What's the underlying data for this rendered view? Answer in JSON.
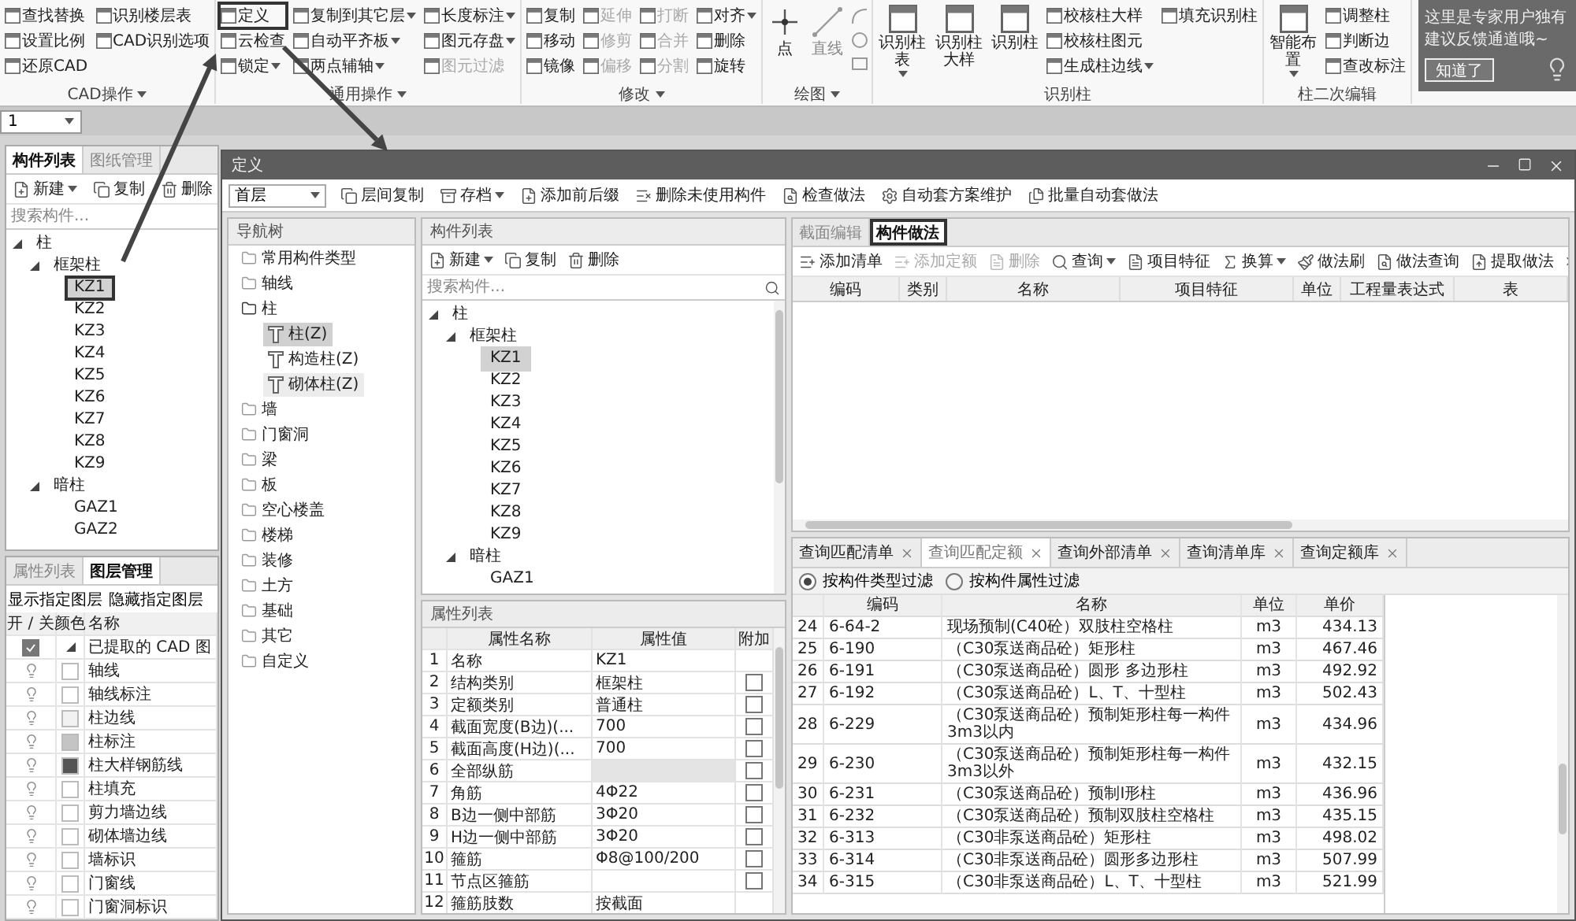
{
  "ribbon": {
    "groups": [
      {
        "label": "CAD操作",
        "dropdown": true,
        "columns": [
          {
            "kind": "small",
            "items": [
              {
                "label": "查找替换",
                "dropdown": false,
                "disabled": false,
                "outlined": false
              },
              {
                "label": "设置比例",
                "dropdown": false,
                "disabled": false,
                "outlined": false
              },
              {
                "label": "还原CAD",
                "dropdown": false,
                "disabled": false,
                "outlined": false
              }
            ]
          },
          {
            "kind": "small",
            "items": [
              {
                "label": "识别楼层表",
                "dropdown": false,
                "disabled": false,
                "outlined": false
              },
              {
                "label": "CAD识别选项",
                "dropdown": false,
                "disabled": false,
                "outlined": false
              }
            ]
          }
        ]
      },
      {
        "label": "通用操作",
        "dropdown": true,
        "columns": [
          {
            "kind": "small",
            "items": [
              {
                "label": "定义",
                "dropdown": false,
                "disabled": false,
                "outlined": true
              },
              {
                "label": "云检查",
                "dropdown": false,
                "disabled": false,
                "outlined": false
              },
              {
                "label": "锁定",
                "dropdown": true,
                "disabled": false,
                "outlined": false
              }
            ]
          },
          {
            "kind": "small",
            "items": [
              {
                "label": "复制到其它层",
                "dropdown": true,
                "disabled": false,
                "outlined": false
              },
              {
                "label": "自动平齐板",
                "dropdown": true,
                "disabled": false,
                "outlined": false
              },
              {
                "label": "两点辅轴",
                "dropdown": true,
                "disabled": false,
                "outlined": false
              }
            ]
          },
          {
            "kind": "small",
            "items": [
              {
                "label": "长度标注",
                "dropdown": true,
                "disabled": false,
                "outlined": false
              },
              {
                "label": "图元存盘",
                "dropdown": true,
                "disabled": false,
                "outlined": false
              },
              {
                "label": "图元过滤",
                "dropdown": false,
                "disabled": true,
                "outlined": false
              }
            ]
          }
        ]
      },
      {
        "label": "修改",
        "dropdown": true,
        "columns": [
          {
            "kind": "small",
            "items": [
              {
                "label": "复制",
                "dropdown": false,
                "disabled": false,
                "outlined": false
              },
              {
                "label": "移动",
                "dropdown": false,
                "disabled": false,
                "outlined": false
              },
              {
                "label": "镜像",
                "dropdown": false,
                "disabled": false,
                "outlined": false
              }
            ]
          },
          {
            "kind": "small",
            "items": [
              {
                "label": "延伸",
                "dropdown": false,
                "disabled": true,
                "outlined": false
              },
              {
                "label": "修剪",
                "dropdown": false,
                "disabled": true,
                "outlined": false
              },
              {
                "label": "偏移",
                "dropdown": false,
                "disabled": true,
                "outlined": false
              }
            ]
          },
          {
            "kind": "small",
            "items": [
              {
                "label": "打断",
                "dropdown": false,
                "disabled": true,
                "outlined": false
              },
              {
                "label": "合并",
                "dropdown": false,
                "disabled": true,
                "outlined": false
              },
              {
                "label": "分割",
                "dropdown": false,
                "disabled": true,
                "outlined": false
              }
            ]
          },
          {
            "kind": "small",
            "items": [
              {
                "label": "对齐",
                "dropdown": true,
                "disabled": false,
                "outlined": false
              },
              {
                "label": "删除",
                "dropdown": false,
                "disabled": false,
                "outlined": false
              },
              {
                "label": "旋转",
                "dropdown": false,
                "disabled": false,
                "outlined": false
              }
            ]
          }
        ]
      },
      {
        "label": "绘图",
        "dropdown": true,
        "columns": [
          {
            "kind": "tools",
            "items": [
              {
                "label": "点",
                "dropdown": false,
                "disabled": false,
                "outlined": false
              },
              {
                "label": "直线",
                "dropdown": false,
                "disabled": true,
                "outlined": false
              }
            ]
          },
          {
            "kind": "shapes"
          }
        ]
      },
      {
        "label": "识别柱",
        "dropdown": false,
        "columns": [
          {
            "kind": "large",
            "items": [
              {
                "label": "识别柱表",
                "dropdown": true,
                "disabled": false,
                "outlined": false
              },
              {
                "label": "识别柱大样",
                "dropdown": false,
                "disabled": false,
                "outlined": false
              },
              {
                "label": "识别柱",
                "dropdown": false,
                "disabled": false,
                "outlined": false
              }
            ]
          },
          {
            "kind": "small",
            "items": [
              {
                "label": "校核柱大样",
                "dropdown": false,
                "disabled": false,
                "outlined": false
              },
              {
                "label": "校核柱图元",
                "dropdown": false,
                "disabled": false,
                "outlined": false
              },
              {
                "label": "生成柱边线",
                "dropdown": true,
                "disabled": false,
                "outlined": false
              }
            ]
          },
          {
            "kind": "small",
            "items": [
              {
                "label": "填充识别柱",
                "dropdown": false,
                "disabled": false,
                "outlined": false
              }
            ]
          }
        ]
      },
      {
        "label": "柱二次编辑",
        "dropdown": false,
        "columns": [
          {
            "kind": "large",
            "items": [
              {
                "label": "智能布置",
                "dropdown": true,
                "disabled": false,
                "outlined": false
              }
            ]
          },
          {
            "kind": "small",
            "items": [
              {
                "label": "调整柱",
                "dropdown": false,
                "disabled": false,
                "outlined": false
              },
              {
                "label": "判断边",
                "dropdown": false,
                "disabled": false,
                "outlined": false
              },
              {
                "label": "查改标注",
                "dropdown": false,
                "disabled": false,
                "outlined": false
              }
            ]
          }
        ]
      }
    ]
  },
  "tooltip": {
    "lines": [
      "这里是专家用户独有",
      "建议反馈通道哦~"
    ],
    "button": "知道了"
  },
  "floor_select": {
    "value": "1"
  },
  "component_panel": {
    "tabs": [
      {
        "label": "构件列表",
        "selected": true
      },
      {
        "label": "图纸管理",
        "selected": false
      }
    ],
    "toolbar": [
      {
        "label": "新建",
        "dropdown": true
      },
      {
        "label": "复制",
        "dropdown": false
      },
      {
        "label": "删除",
        "dropdown": false
      }
    ],
    "search": {
      "placeholder": "搜索构件..."
    },
    "tree": [
      {
        "label": "柱",
        "expanded": true,
        "selected": false,
        "outlined": false,
        "children": [
          {
            "label": "框架柱",
            "expanded": true,
            "selected": false,
            "outlined": false,
            "children": [
              {
                "label": "KZ1",
                "selected": true,
                "outlined": true
              },
              {
                "label": "KZ2",
                "selected": false,
                "outlined": false
              },
              {
                "label": "KZ3",
                "selected": false,
                "outlined": false
              },
              {
                "label": "KZ4",
                "selected": false,
                "outlined": false
              },
              {
                "label": "KZ5",
                "selected": false,
                "outlined": false
              },
              {
                "label": "KZ6",
                "selected": false,
                "outlined": false
              },
              {
                "label": "KZ7",
                "selected": false,
                "outlined": false
              },
              {
                "label": "KZ8",
                "selected": false,
                "outlined": false
              },
              {
                "label": "KZ9",
                "selected": false,
                "outlined": false
              }
            ]
          },
          {
            "label": "暗柱",
            "expanded": true,
            "selected": false,
            "outlined": false,
            "children": [
              {
                "label": "GAZ1",
                "selected": false,
                "outlined": false
              },
              {
                "label": "GAZ2",
                "selected": false,
                "outlined": false
              }
            ]
          }
        ]
      }
    ]
  },
  "layer_panel": {
    "tabs": [
      {
        "label": "属性列表",
        "selected": false
      },
      {
        "label": "图层管理",
        "selected": true
      }
    ],
    "buttons": [
      "显示指定图层",
      "隐藏指定图层"
    ],
    "columns": [
      "开 / 关",
      "颜色",
      "名称"
    ],
    "rows": [
      {
        "kind": "group",
        "name": "已提取的 CAD 图",
        "checked": true
      },
      {
        "kind": "layer",
        "name": "轴线",
        "color": "#ffffff"
      },
      {
        "kind": "layer",
        "name": "轴线标注",
        "color": "#ffffff"
      },
      {
        "kind": "layer",
        "name": "柱边线",
        "color": "#f2f2f2"
      },
      {
        "kind": "layer",
        "name": "柱标注",
        "color": "#c4c4c4"
      },
      {
        "kind": "layer",
        "name": "柱大样钢筋线",
        "color": "#555555"
      },
      {
        "kind": "layer",
        "name": "柱填充",
        "color": "#ffffff"
      },
      {
        "kind": "layer",
        "name": "剪力墙边线",
        "color": "#ffffff"
      },
      {
        "kind": "layer",
        "name": "砌体墙边线",
        "color": "#ffffff"
      },
      {
        "kind": "layer",
        "name": "墙标识",
        "color": "#ffffff"
      },
      {
        "kind": "layer",
        "name": "门窗线",
        "color": "#ffffff"
      },
      {
        "kind": "layer",
        "name": "门窗洞标识",
        "color": "#ffffff"
      }
    ]
  },
  "dialog": {
    "title": "定义",
    "toolbar": {
      "floor": "首层",
      "items": [
        {
          "label": "层间复制",
          "dropdown": false
        },
        {
          "label": "存档",
          "dropdown": true
        },
        {
          "label": "添加前后缀",
          "dropdown": false
        },
        {
          "label": "删除未使用构件",
          "dropdown": false
        },
        {
          "label": "检查做法",
          "dropdown": false
        },
        {
          "label": "自动套方案维护",
          "dropdown": false
        },
        {
          "label": "批量自动套做法",
          "dropdown": false
        }
      ]
    },
    "nav": {
      "title": "导航树",
      "items": [
        {
          "label": "常用构件类型",
          "expanded": false
        },
        {
          "label": "轴线",
          "expanded": false
        },
        {
          "label": "柱",
          "expanded": true,
          "children": [
            {
              "label": "柱(Z)",
              "selected": true,
              "hovered": false
            },
            {
              "label": "构造柱(Z)",
              "selected": false,
              "hovered": false
            },
            {
              "label": "砌体柱(Z)",
              "selected": false,
              "hovered": true
            }
          ]
        },
        {
          "label": "墙",
          "expanded": false
        },
        {
          "label": "门窗洞",
          "expanded": false
        },
        {
          "label": "梁",
          "expanded": false
        },
        {
          "label": "板",
          "expanded": false
        },
        {
          "label": "空心楼盖",
          "expanded": false
        },
        {
          "label": "楼梯",
          "expanded": false
        },
        {
          "label": "装修",
          "expanded": false
        },
        {
          "label": "土方",
          "expanded": false
        },
        {
          "label": "基础",
          "expanded": false
        },
        {
          "label": "其它",
          "expanded": false
        },
        {
          "label": "自定义",
          "expanded": false
        }
      ]
    },
    "components": {
      "title": "构件列表",
      "toolbar": [
        {
          "label": "新建",
          "dropdown": true
        },
        {
          "label": "复制",
          "dropdown": false
        },
        {
          "label": "删除",
          "dropdown": false
        }
      ],
      "search": {
        "placeholder": "搜索构件..."
      },
      "tree": [
        {
          "label": "柱",
          "expanded": true,
          "selected": false,
          "children": [
            {
              "label": "框架柱",
              "expanded": true,
              "selected": false,
              "children": [
                {
                  "label": "KZ1",
                  "selected": true
                },
                {
                  "label": "KZ2",
                  "selected": false
                },
                {
                  "label": "KZ3",
                  "selected": false
                },
                {
                  "label": "KZ4",
                  "selected": false
                },
                {
                  "label": "KZ5",
                  "selected": false
                },
                {
                  "label": "KZ6",
                  "selected": false
                },
                {
                  "label": "KZ7",
                  "selected": false
                },
                {
                  "label": "KZ8",
                  "selected": false
                },
                {
                  "label": "KZ9",
                  "selected": false
                }
              ]
            },
            {
              "label": "暗柱",
              "expanded": true,
              "selected": false,
              "children": [
                {
                  "label": "GAZ1",
                  "selected": false
                }
              ]
            }
          ]
        }
      ]
    },
    "properties": {
      "title": "属性列表",
      "columns": [
        "属性名称",
        "属性值",
        "附加"
      ],
      "rows": [
        {
          "index": "1",
          "name": "名称",
          "value": "KZ1",
          "kind": "plain",
          "disabled": false
        },
        {
          "index": "2",
          "name": "结构类别",
          "value": "框架柱",
          "kind": "check",
          "checked": false,
          "disabled": false
        },
        {
          "index": "3",
          "name": "定额类别",
          "value": "普通柱",
          "kind": "check",
          "checked": false,
          "disabled": false
        },
        {
          "index": "4",
          "name": "截面宽度(B边)(...",
          "value": "700",
          "kind": "check",
          "checked": false,
          "disabled": false
        },
        {
          "index": "5",
          "name": "截面高度(H边)(...",
          "value": "700",
          "kind": "check",
          "checked": false,
          "disabled": false
        },
        {
          "index": "6",
          "name": "全部纵筋",
          "kind": "check",
          "checked": false,
          "disabled": true
        },
        {
          "index": "7",
          "name": "角筋",
          "value": "4Φ22",
          "kind": "check",
          "checked": false,
          "disabled": false
        },
        {
          "index": "8",
          "name": "B边一侧中部筋",
          "value": "3Φ20",
          "kind": "check",
          "checked": false,
          "disabled": false
        },
        {
          "index": "9",
          "name": "H边一侧中部筋",
          "value": "3Φ20",
          "kind": "check",
          "checked": false,
          "disabled": false
        },
        {
          "index": "10",
          "name": "箍筋",
          "value": "Φ8@100/200",
          "kind": "check",
          "checked": false,
          "disabled": false
        },
        {
          "index": "11",
          "name": "节点区箍筋",
          "kind": "check",
          "checked": false,
          "disabled": false
        },
        {
          "index": "12",
          "name": "箍筋肢数",
          "value": "按截面",
          "kind": "plain",
          "disabled": false
        }
      ]
    },
    "methods": {
      "tabs": [
        {
          "label": "截面编辑",
          "selected": false,
          "outlined": false
        },
        {
          "label": "构件做法",
          "selected": true,
          "outlined": true
        }
      ],
      "toolbar": [
        {
          "label": "添加清单",
          "dropdown": false,
          "disabled": false
        },
        {
          "label": "添加定额",
          "dropdown": false,
          "disabled": true
        },
        {
          "label": "删除",
          "dropdown": false,
          "disabled": true
        },
        {
          "label": "查询",
          "dropdown": true,
          "disabled": false
        },
        {
          "label": "项目特征",
          "dropdown": false,
          "disabled": false
        },
        {
          "label": "换算",
          "dropdown": true,
          "disabled": false
        },
        {
          "label": "做法刷",
          "dropdown": false,
          "disabled": false
        },
        {
          "label": "做法查询",
          "dropdown": false,
          "disabled": false
        },
        {
          "label": "提取做法",
          "dropdown": false,
          "disabled": false
        }
      ],
      "columns": [
        "编码",
        "类别",
        "名称",
        "项目特征",
        "单位",
        "工程量表达式",
        "表"
      ]
    },
    "query": {
      "tabs": [
        {
          "label": "查询匹配清单",
          "selected": false
        },
        {
          "label": "查询匹配定额",
          "selected": true
        },
        {
          "label": "查询外部清单",
          "selected": false
        },
        {
          "label": "查询清单库",
          "selected": false
        },
        {
          "label": "查询定额库",
          "selected": false
        }
      ],
      "filters": [
        {
          "label": "按构件类型过滤",
          "selected": true
        },
        {
          "label": "按构件属性过滤",
          "selected": false
        }
      ],
      "columns": [
        "编码",
        "名称",
        "单位",
        "单价"
      ],
      "rows": [
        {
          "index": "24",
          "code": "6-64-2",
          "name": "现场预制(C40砼）双肢柱空格柱",
          "unit": "m3",
          "price": "434.13"
        },
        {
          "index": "25",
          "code": "6-190",
          "name": "（C30泵送商品砼）矩形柱",
          "unit": "m3",
          "price": "467.46"
        },
        {
          "index": "26",
          "code": "6-191",
          "name": "（C30泵送商品砼）圆形 多边形柱",
          "unit": "m3",
          "price": "492.92"
        },
        {
          "index": "27",
          "code": "6-192",
          "name": "（C30泵送商品砼）L、T、十型柱",
          "unit": "m3",
          "price": "502.43"
        },
        {
          "index": "28",
          "code": "6-229",
          "name": "（C30泵送商品砼）预制矩形柱每一构件 3m3以内",
          "unit": "m3",
          "price": "434.96"
        },
        {
          "index": "29",
          "code": "6-230",
          "name": "（C30泵送商品砼）预制矩形柱每一构件 3m3以外",
          "unit": "m3",
          "price": "432.15"
        },
        {
          "index": "30",
          "code": "6-231",
          "name": "（C30泵送商品砼）预制I形柱",
          "unit": "m3",
          "price": "436.96"
        },
        {
          "index": "31",
          "code": "6-232",
          "name": "（C30泵送商品砼）预制双肢柱空格柱",
          "unit": "m3",
          "price": "435.15"
        },
        {
          "index": "32",
          "code": "6-313",
          "name": "（C30非泵送商品砼）矩形柱",
          "unit": "m3",
          "price": "498.02"
        },
        {
          "index": "33",
          "code": "6-314",
          "name": "（C30非泵送商品砼）圆形多边形柱",
          "unit": "m3",
          "price": "507.99"
        },
        {
          "index": "34",
          "code": "6-315",
          "name": "（C30非泵送商品砼）L、T、十型柱",
          "unit": "m3",
          "price": "521.99"
        }
      ]
    }
  }
}
